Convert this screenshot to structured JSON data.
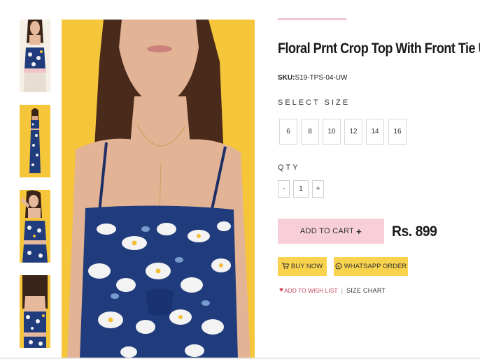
{
  "product": {
    "title": "Floral Prnt Crop Top With Front Tie Up",
    "sku_label": "SKU:",
    "sku_value": "S19-TPS-04-UW",
    "price": "Rs. 899"
  },
  "size_selector": {
    "label": "SELECT SIZE",
    "options": [
      "6",
      "8",
      "10",
      "12",
      "14",
      "16"
    ]
  },
  "quantity": {
    "label": "QTY",
    "minus": "-",
    "value": "1",
    "plus": "+"
  },
  "actions": {
    "add_to_cart": "ADD TO CART",
    "add_to_cart_icon": "+",
    "buy_now": "BUY NOW",
    "whatsapp_order": "WHATSAPP ORDER",
    "wishlist": "ADD TO WISH LIST",
    "size_chart": "SIZE CHART",
    "separator": "|"
  },
  "icons": {
    "buy_now": "cart-icon",
    "whatsapp": "whatsapp-icon",
    "wishlist": "heart-icon"
  },
  "colors": {
    "cart_button": "#f8cfd8",
    "action_buttons": "#f9d34d",
    "accent_bar": "#f2c6cf",
    "photo_background": "#f6c63a",
    "print_navy": "#1f3a7a"
  }
}
